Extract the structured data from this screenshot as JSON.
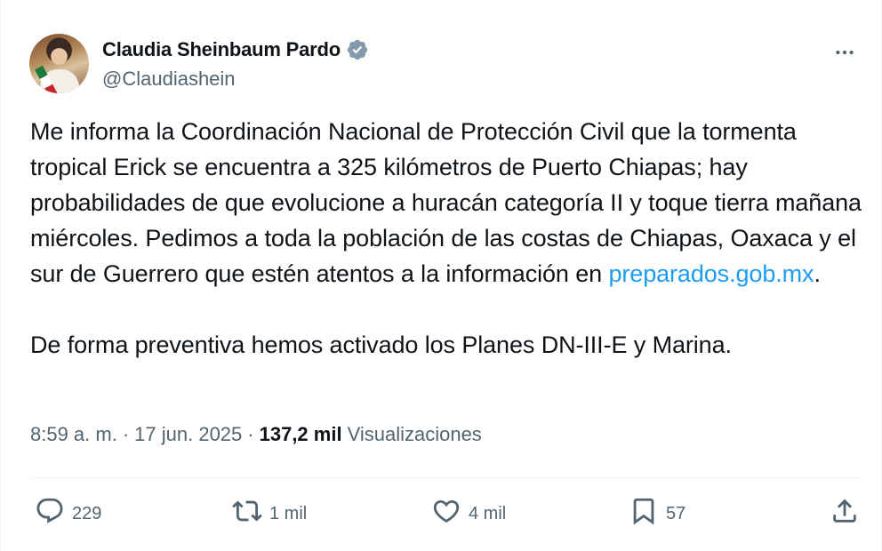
{
  "author": {
    "display_name": "Claudia Sheinbaum Pardo",
    "handle": "@Claudiashein",
    "verified": true,
    "verified_color": "#829aab"
  },
  "tweet": {
    "text_part1": "Me informa la Coordinación Nacional de Protección Civil que la tormenta tropical Erick se encuentra a 325 kilómetros de Puerto Chiapas; hay probabilidades de que evolucione a huracán categoría II y toque tierra mañana miércoles. Pedimos a toda la población de las costas de Chiapas, Oaxaca y el sur de Guerrero que estén atentos a la información en ",
    "link_text": "preparados.gob.mx",
    "text_part1_end": ".",
    "text_part2": "De forma preventiva hemos activado los Planes DN-III-E y Marina.",
    "link_color": "#1d9bf0"
  },
  "meta": {
    "time": "8:59 a. m.",
    "separator": "·",
    "date": "17 jun. 2025",
    "views_count": "137,2 mil",
    "views_label": "Visualizaciones"
  },
  "actions": {
    "replies": "229",
    "reposts": "1 mil",
    "likes": "4 mil",
    "bookmarks": "57"
  },
  "icons": {
    "more": "more-horizontal-icon",
    "reply": "reply-icon",
    "repost": "repost-icon",
    "like": "heart-icon",
    "bookmark": "bookmark-icon",
    "share": "share-icon",
    "verified": "verified-badge-icon"
  }
}
